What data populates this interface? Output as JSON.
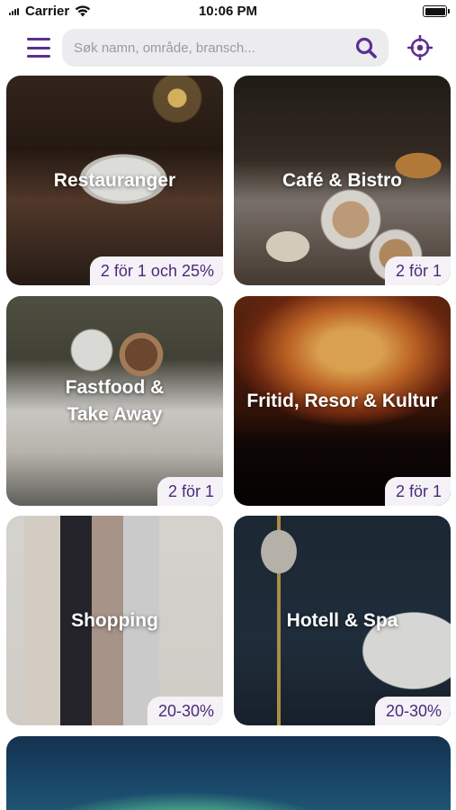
{
  "status_bar": {
    "carrier": "Carrier",
    "time": "10:06 PM"
  },
  "header": {
    "menu_icon": "hamburger-menu-icon",
    "search": {
      "placeholder": "Søk namn, område, bransch...",
      "value": ""
    },
    "search_icon": "search-icon",
    "locate_icon": "crosshair-location-icon",
    "accent_color": "#5b2f91"
  },
  "categories": [
    {
      "title": "Restauranger",
      "badge": "2 för 1 och 25%"
    },
    {
      "title": "Café & Bistro",
      "badge": "2 för 1"
    },
    {
      "title": "Fastfood &\nTake Away",
      "badge": "2 för 1"
    },
    {
      "title": "Fritid, Resor & Kultur",
      "badge": "2 för 1"
    },
    {
      "title": "Shopping",
      "badge": "20-30%"
    },
    {
      "title": "Hotell & Spa",
      "badge": "20-30%"
    }
  ]
}
